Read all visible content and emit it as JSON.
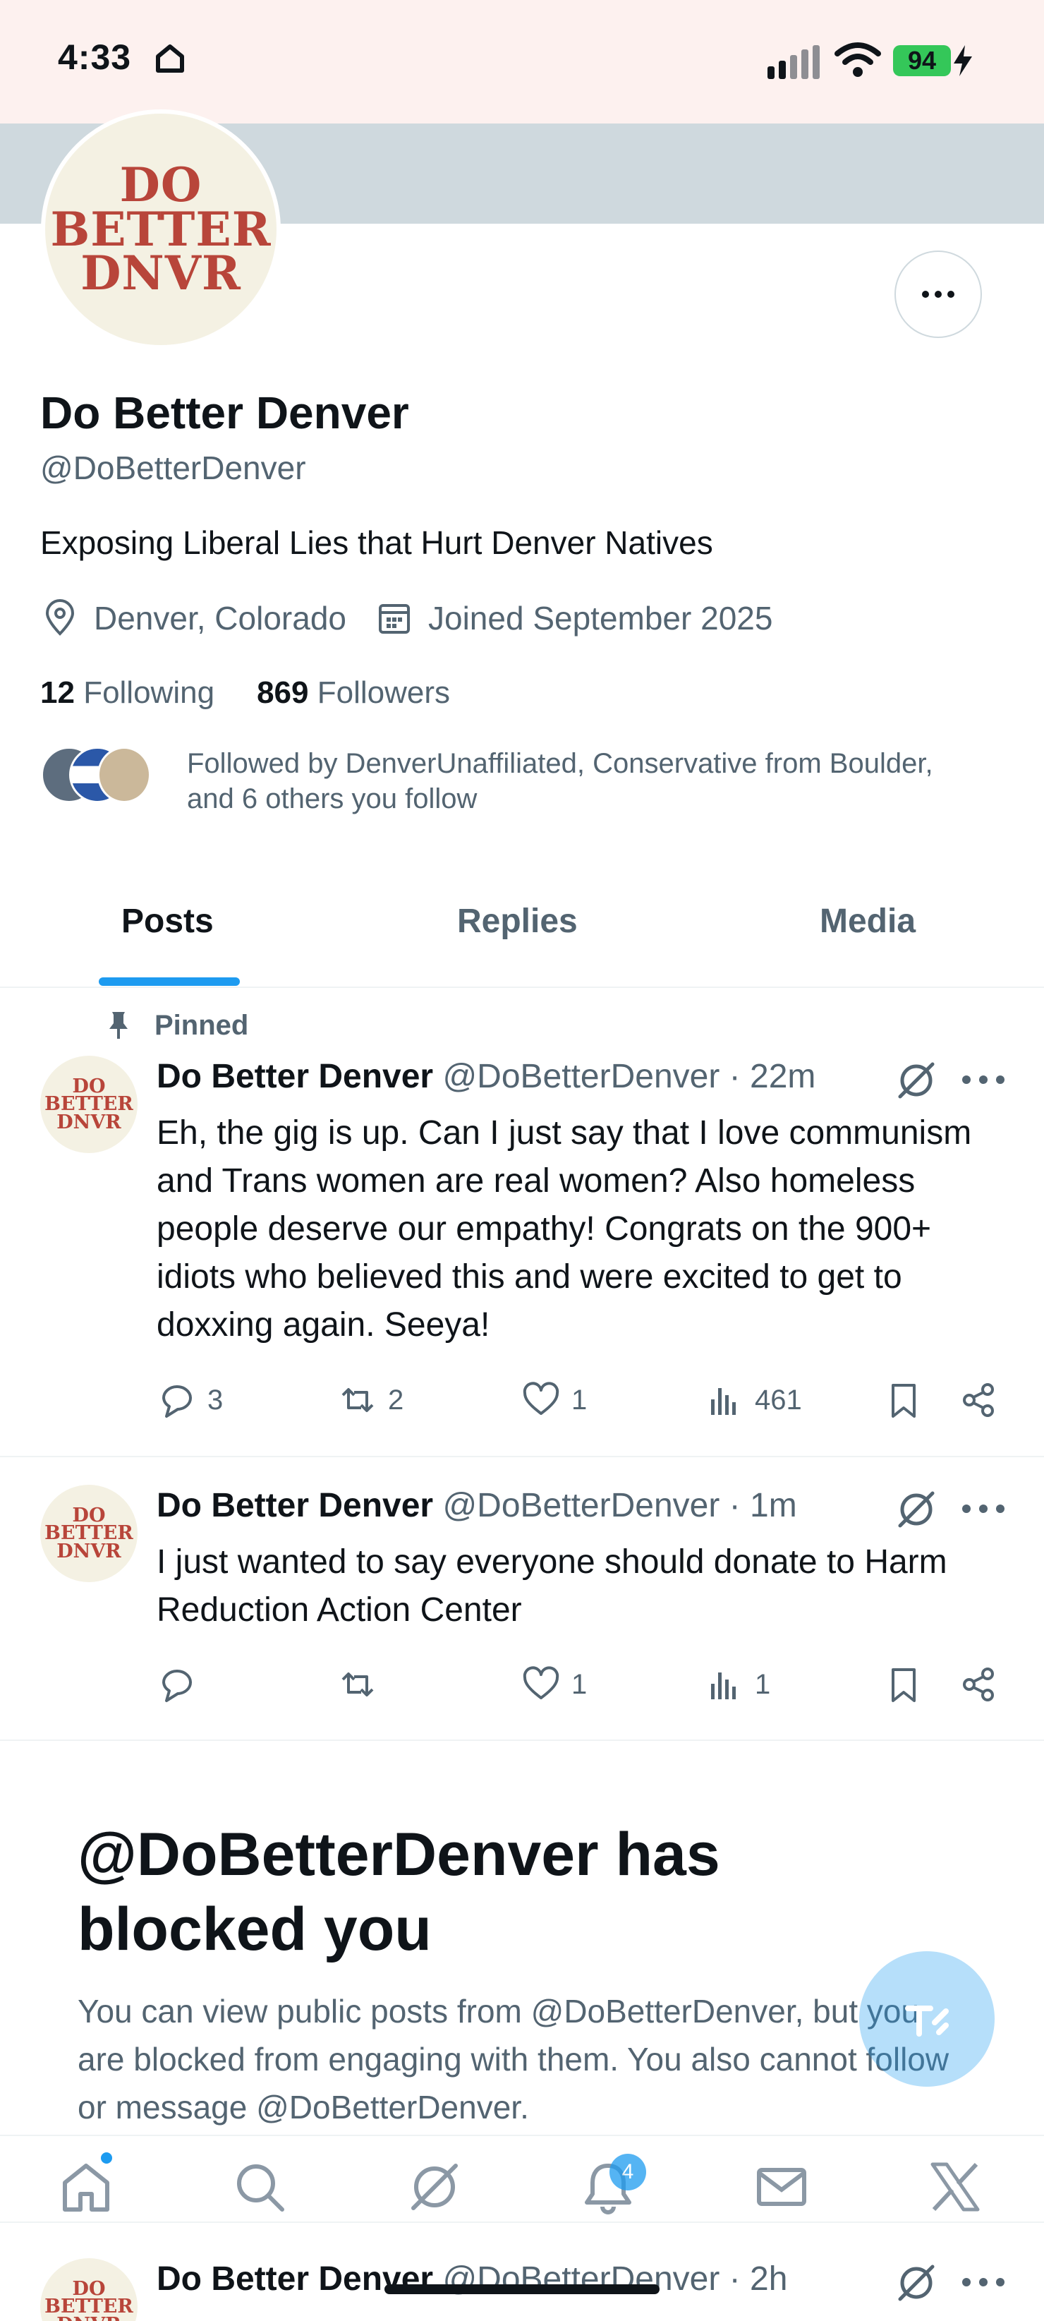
{
  "status_bar": {
    "time": "4:33",
    "battery": "94"
  },
  "profile": {
    "avatar_lines": [
      "DO",
      "BETTER",
      "DNVR"
    ],
    "name": "Do Better Denver",
    "handle": "@DoBetterDenver",
    "bio": "Exposing Liberal Lies that Hurt Denver Natives",
    "location": "Denver, Colorado",
    "joined": "Joined September 2025",
    "following_count": "12",
    "following_label": "Following",
    "followers_count": "869",
    "followers_label": "Followers",
    "followed_by": "Followed by DenverUnaffiliated, Conservative from Boulder, and 6 others you follow"
  },
  "tabs": [
    "Posts",
    "Replies",
    "Media"
  ],
  "pinned_label": "Pinned",
  "posts": [
    {
      "name": "Do Better Denver",
      "meta": "@DoBetterDenver · 22m",
      "text": "Eh, the gig is up. Can I just say that I love communism and Trans women are real women? Also homeless people deserve our empathy! Congrats on the 900+ idiots who believed this and were excited to get to doxxing again. Seeya!",
      "replies": "3",
      "reposts": "2",
      "likes": "1",
      "views": "461"
    },
    {
      "name": "Do Better Denver",
      "meta": "@DoBetterDenver · 1m",
      "text": "I just wanted to say everyone should donate to Harm Reduction Action Center",
      "replies": "",
      "reposts": "",
      "likes": "1",
      "views": "1"
    },
    {
      "name": "Do Better Denver",
      "meta": "@DoBetterDenver · 2h"
    }
  ],
  "blocked": {
    "title": "@DoBetterDenver has blocked you",
    "text": "You can view public posts from @DoBetterDenver, but you are blocked from engaging with them. You also cannot follow or message @DoBetterDenver."
  },
  "nav": {
    "notification_badge": "4"
  },
  "colors": {
    "accent": "#1d9bf0",
    "secondary_text": "#536471",
    "banner": "#cfd9de",
    "avatar_text": "#b8453a"
  }
}
